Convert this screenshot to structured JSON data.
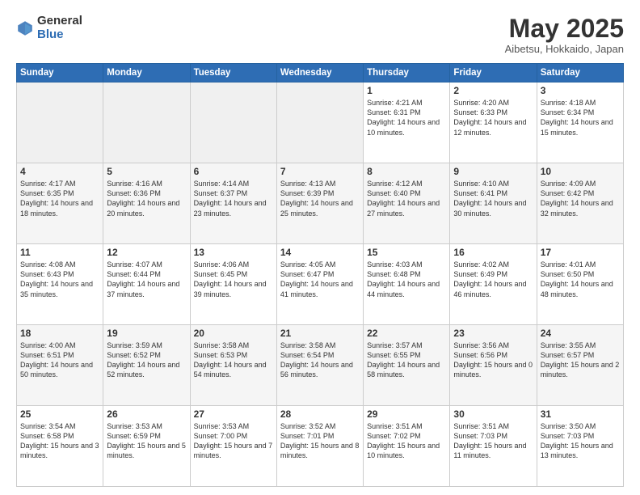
{
  "logo": {
    "general": "General",
    "blue": "Blue"
  },
  "header": {
    "month": "May 2025",
    "location": "Aibetsu, Hokkaido, Japan"
  },
  "weekdays": [
    "Sunday",
    "Monday",
    "Tuesday",
    "Wednesday",
    "Thursday",
    "Friday",
    "Saturday"
  ],
  "weeks": [
    [
      {
        "day": "",
        "detail": ""
      },
      {
        "day": "",
        "detail": ""
      },
      {
        "day": "",
        "detail": ""
      },
      {
        "day": "",
        "detail": ""
      },
      {
        "day": "1",
        "detail": "Sunrise: 4:21 AM\nSunset: 6:31 PM\nDaylight: 14 hours\nand 10 minutes."
      },
      {
        "day": "2",
        "detail": "Sunrise: 4:20 AM\nSunset: 6:33 PM\nDaylight: 14 hours\nand 12 minutes."
      },
      {
        "day": "3",
        "detail": "Sunrise: 4:18 AM\nSunset: 6:34 PM\nDaylight: 14 hours\nand 15 minutes."
      }
    ],
    [
      {
        "day": "4",
        "detail": "Sunrise: 4:17 AM\nSunset: 6:35 PM\nDaylight: 14 hours\nand 18 minutes."
      },
      {
        "day": "5",
        "detail": "Sunrise: 4:16 AM\nSunset: 6:36 PM\nDaylight: 14 hours\nand 20 minutes."
      },
      {
        "day": "6",
        "detail": "Sunrise: 4:14 AM\nSunset: 6:37 PM\nDaylight: 14 hours\nand 23 minutes."
      },
      {
        "day": "7",
        "detail": "Sunrise: 4:13 AM\nSunset: 6:39 PM\nDaylight: 14 hours\nand 25 minutes."
      },
      {
        "day": "8",
        "detail": "Sunrise: 4:12 AM\nSunset: 6:40 PM\nDaylight: 14 hours\nand 27 minutes."
      },
      {
        "day": "9",
        "detail": "Sunrise: 4:10 AM\nSunset: 6:41 PM\nDaylight: 14 hours\nand 30 minutes."
      },
      {
        "day": "10",
        "detail": "Sunrise: 4:09 AM\nSunset: 6:42 PM\nDaylight: 14 hours\nand 32 minutes."
      }
    ],
    [
      {
        "day": "11",
        "detail": "Sunrise: 4:08 AM\nSunset: 6:43 PM\nDaylight: 14 hours\nand 35 minutes."
      },
      {
        "day": "12",
        "detail": "Sunrise: 4:07 AM\nSunset: 6:44 PM\nDaylight: 14 hours\nand 37 minutes."
      },
      {
        "day": "13",
        "detail": "Sunrise: 4:06 AM\nSunset: 6:45 PM\nDaylight: 14 hours\nand 39 minutes."
      },
      {
        "day": "14",
        "detail": "Sunrise: 4:05 AM\nSunset: 6:47 PM\nDaylight: 14 hours\nand 41 minutes."
      },
      {
        "day": "15",
        "detail": "Sunrise: 4:03 AM\nSunset: 6:48 PM\nDaylight: 14 hours\nand 44 minutes."
      },
      {
        "day": "16",
        "detail": "Sunrise: 4:02 AM\nSunset: 6:49 PM\nDaylight: 14 hours\nand 46 minutes."
      },
      {
        "day": "17",
        "detail": "Sunrise: 4:01 AM\nSunset: 6:50 PM\nDaylight: 14 hours\nand 48 minutes."
      }
    ],
    [
      {
        "day": "18",
        "detail": "Sunrise: 4:00 AM\nSunset: 6:51 PM\nDaylight: 14 hours\nand 50 minutes."
      },
      {
        "day": "19",
        "detail": "Sunrise: 3:59 AM\nSunset: 6:52 PM\nDaylight: 14 hours\nand 52 minutes."
      },
      {
        "day": "20",
        "detail": "Sunrise: 3:58 AM\nSunset: 6:53 PM\nDaylight: 14 hours\nand 54 minutes."
      },
      {
        "day": "21",
        "detail": "Sunrise: 3:58 AM\nSunset: 6:54 PM\nDaylight: 14 hours\nand 56 minutes."
      },
      {
        "day": "22",
        "detail": "Sunrise: 3:57 AM\nSunset: 6:55 PM\nDaylight: 14 hours\nand 58 minutes."
      },
      {
        "day": "23",
        "detail": "Sunrise: 3:56 AM\nSunset: 6:56 PM\nDaylight: 15 hours\nand 0 minutes."
      },
      {
        "day": "24",
        "detail": "Sunrise: 3:55 AM\nSunset: 6:57 PM\nDaylight: 15 hours\nand 2 minutes."
      }
    ],
    [
      {
        "day": "25",
        "detail": "Sunrise: 3:54 AM\nSunset: 6:58 PM\nDaylight: 15 hours\nand 3 minutes."
      },
      {
        "day": "26",
        "detail": "Sunrise: 3:53 AM\nSunset: 6:59 PM\nDaylight: 15 hours\nand 5 minutes."
      },
      {
        "day": "27",
        "detail": "Sunrise: 3:53 AM\nSunset: 7:00 PM\nDaylight: 15 hours\nand 7 minutes."
      },
      {
        "day": "28",
        "detail": "Sunrise: 3:52 AM\nSunset: 7:01 PM\nDaylight: 15 hours\nand 8 minutes."
      },
      {
        "day": "29",
        "detail": "Sunrise: 3:51 AM\nSunset: 7:02 PM\nDaylight: 15 hours\nand 10 minutes."
      },
      {
        "day": "30",
        "detail": "Sunrise: 3:51 AM\nSunset: 7:03 PM\nDaylight: 15 hours\nand 11 minutes."
      },
      {
        "day": "31",
        "detail": "Sunrise: 3:50 AM\nSunset: 7:03 PM\nDaylight: 15 hours\nand 13 minutes."
      }
    ]
  ]
}
